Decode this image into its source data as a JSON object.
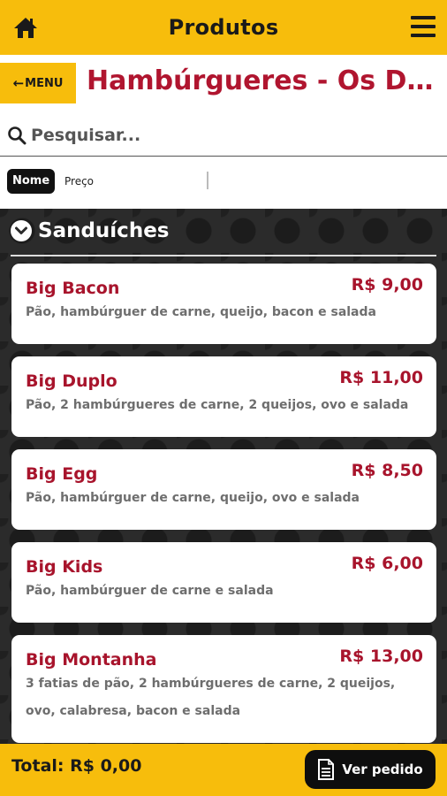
{
  "header": {
    "title": "Produtos",
    "home_icon": "home-icon",
    "menu_icon": "hamburger-menu-icon"
  },
  "category": {
    "back_label": "MENU",
    "title": "Hambúrgueres - Os Dois Irmãos"
  },
  "search": {
    "placeholder": "Pesquisar..."
  },
  "sort": {
    "active": "Nome",
    "other": "Preço"
  },
  "section": {
    "title": "Sanduíches"
  },
  "products": [
    {
      "name": "Big Bacon",
      "price": "R$ 9,00",
      "description": "Pão, hambúrguer de carne, queijo, bacon e salada"
    },
    {
      "name": "Big Duplo",
      "price": "R$ 11,00",
      "description": "Pão, 2 hambúrgueres de carne, 2 queijos, ovo e salada"
    },
    {
      "name": "Big Egg",
      "price": "R$ 8,50",
      "description": "Pão, hambúrguer de carne, queijo, ovo e salada"
    },
    {
      "name": "Big Kids",
      "price": "R$ 6,00",
      "description": "Pão, hambúrguer de carne e salada"
    },
    {
      "name": "Big Montanha",
      "price": "R$ 13,00",
      "description": "3 fatias de pão, 2 hambúrgueres de carne, 2 queijos, ovo, calabresa, bacon e salada"
    }
  ],
  "footer": {
    "total": "Total: R$ 0,00",
    "order_button": "Ver pedido"
  },
  "colors": {
    "accent": "#f7bd0c",
    "product_red": "#a8142c",
    "title_red": "#b0152f",
    "dark": "#0e0e0e"
  }
}
